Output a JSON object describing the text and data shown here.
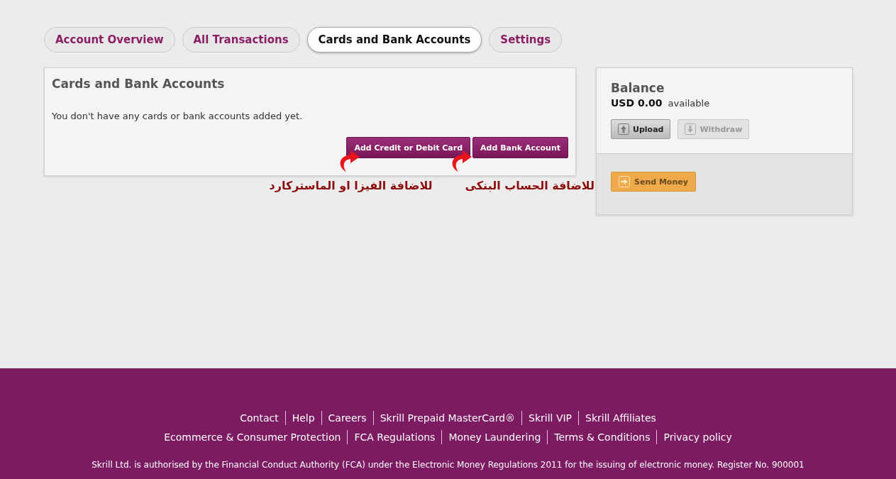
{
  "tabs": [
    {
      "label": "Account Overview",
      "selected": false
    },
    {
      "label": "All Transactions",
      "selected": false
    },
    {
      "label": "Cards and Bank Accounts",
      "selected": true
    },
    {
      "label": "Settings",
      "selected": false
    }
  ],
  "cards_panel": {
    "title": "Cards and Bank Accounts",
    "message": "You don't have any cards or bank accounts added yet.",
    "buttons": [
      "Add Credit or Debit Card",
      "Add Bank Account"
    ]
  },
  "annotations": [
    "للاضافة الحساب البنكى",
    "للاضافة الفيزا او الماستركارد"
  ],
  "balance_panel": {
    "title": "Balance",
    "amount": "USD 0.00",
    "amount_note": "available",
    "actions": [
      {
        "label": "Upload",
        "kind": "upload",
        "disabled": false
      },
      {
        "label": "Withdraw",
        "kind": "withdraw",
        "disabled": true
      }
    ],
    "send_button": "Send Money"
  },
  "footer": {
    "links_row_1": [
      "Contact",
      "Help",
      "Careers",
      "Skrill Prepaid MasterCard®",
      "Skrill VIP",
      "Skrill Affiliates"
    ],
    "links_row_2": [
      "Ecommerce & Consumer Protection",
      "FCA Regulations",
      "Money Laundering",
      "Terms & Conditions",
      "Privacy policy"
    ],
    "legal": "Skrill Ltd. is authorised by the Financial Conduct Authority (FCA) under the Electronic Money Regulations 2011 for the issuing of electronic money. Register No. 900001"
  }
}
